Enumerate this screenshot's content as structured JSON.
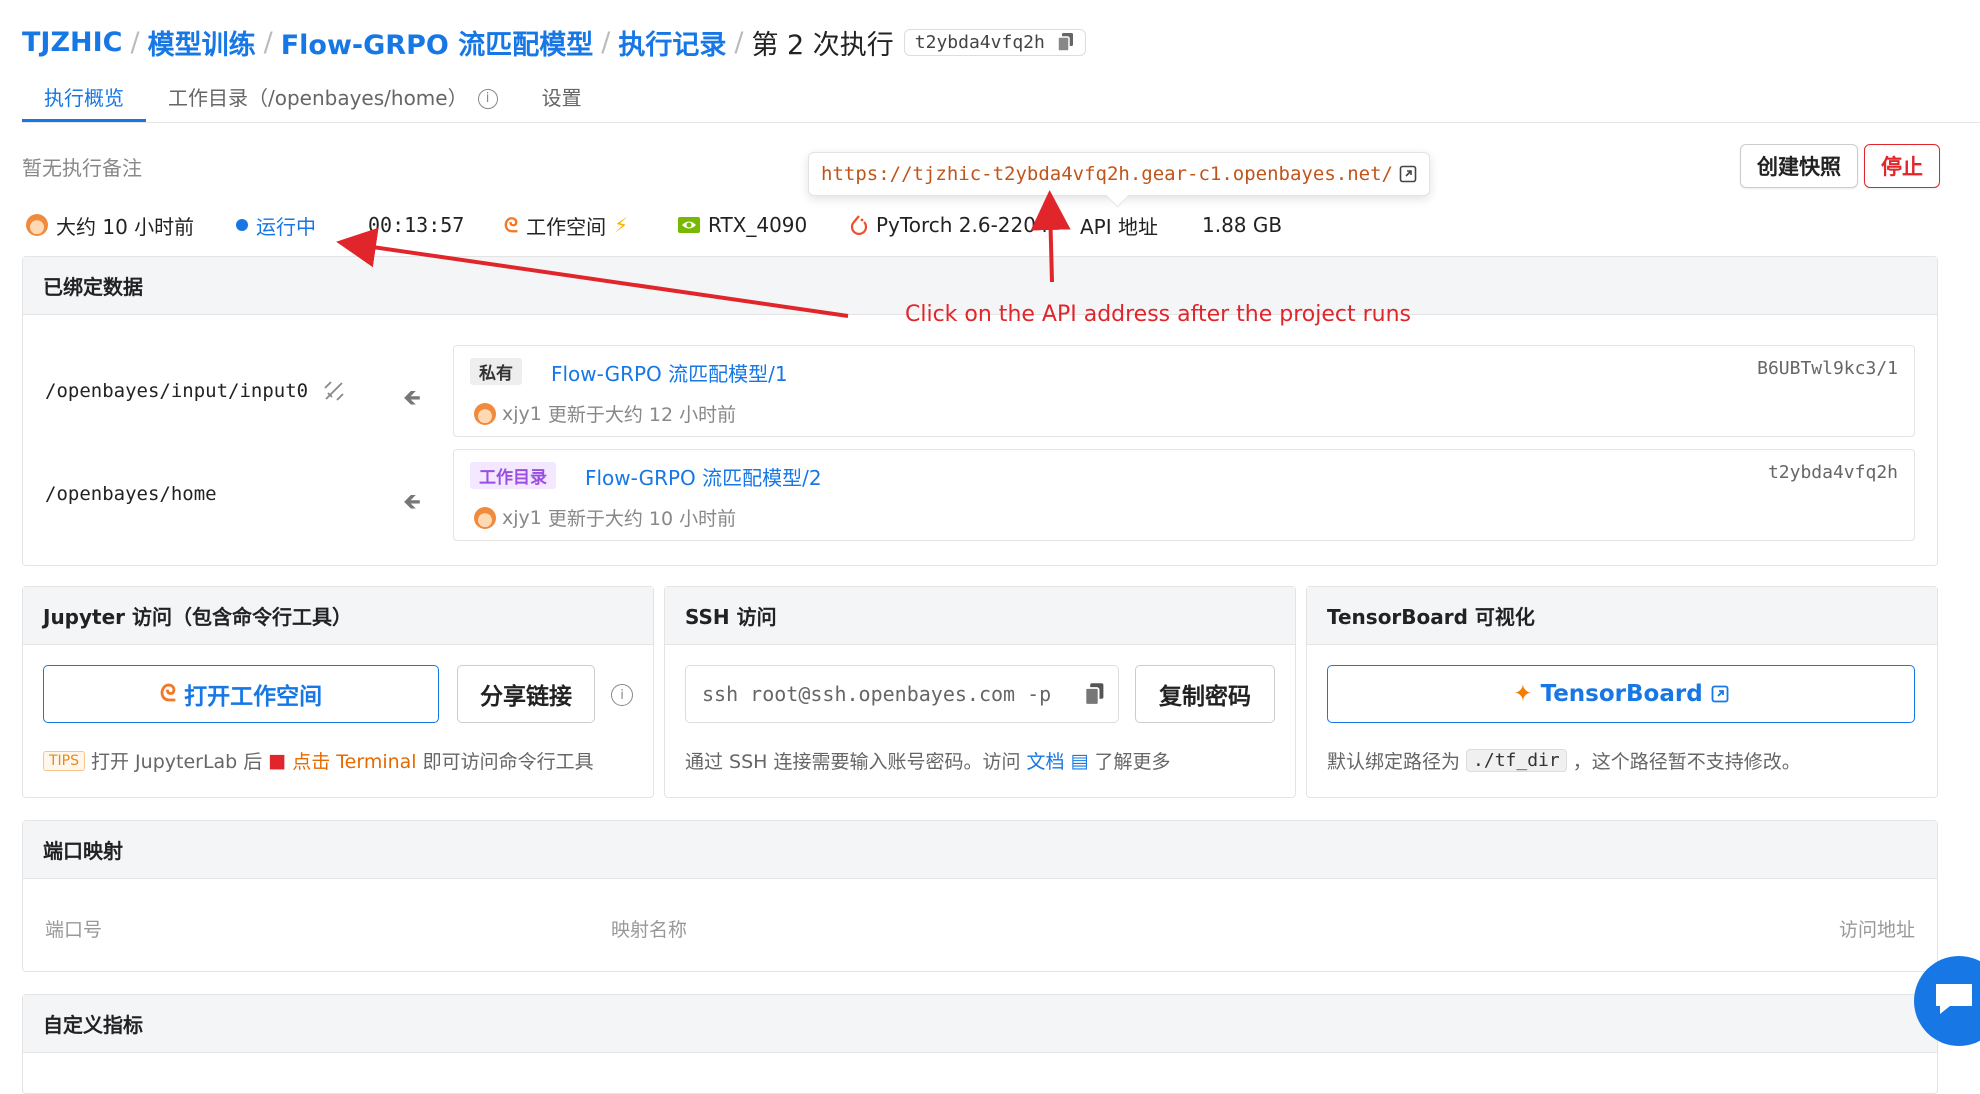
{
  "breadcrumb": {
    "items": [
      "TJZHIC",
      "模型训练",
      "Flow-GRPO 流匹配模型",
      "执行记录"
    ],
    "current": "第 2 次执行",
    "run_id": "t2ybda4vfq2h"
  },
  "tabs": [
    {
      "label": "执行概览",
      "active": true
    },
    {
      "label": "工作目录（/openbayes/home）",
      "active": false
    },
    {
      "label": "设置",
      "active": false
    }
  ],
  "note": "暂无执行备注",
  "actions": {
    "snapshot": "创建快照",
    "stop": "停止"
  },
  "api_popover": {
    "url": "https://tjzhic-t2ybda4vfq2h.gear-c1.openbayes.net/"
  },
  "status": {
    "time": "大约 10 小时前",
    "state": "运行中",
    "duration": "00:13:57",
    "workspace": "工作空间",
    "gpu": "RTX_4090",
    "framework": "PyTorch 2.6-2204",
    "api": "API 地址",
    "size": "1.88 GB"
  },
  "annotation": "Click on the API address after the project runs",
  "bound_data": {
    "title": "已绑定数据",
    "rows": [
      {
        "path": "/openbayes/input/input0",
        "badge": "私有",
        "name": "Flow-GRPO 流匹配模型/1",
        "hash": "B6UBTwl9kc3/1",
        "user": "xjy1",
        "meta": "更新于大约 12 小时前"
      },
      {
        "path": "/openbayes/home",
        "badge": "工作目录",
        "name": "Flow-GRPO 流匹配模型/2",
        "hash": "t2ybda4vfq2h",
        "user": "xjy1",
        "meta": "更新于大约 10 小时前"
      }
    ]
  },
  "jupyter": {
    "title": "Jupyter 访问（包含命令行工具）",
    "open_label": "打开工作空间",
    "share_label": "分享链接",
    "tips": "TIPS",
    "desc_pre": "打开 JupyterLab 后",
    "desc_link": "点击 Terminal",
    "desc_post": "即可访问命令行工具"
  },
  "ssh": {
    "title": "SSH 访问",
    "command": "ssh root@ssh.openbayes.com -p",
    "copy_label": "复制密码",
    "desc_pre": "通过 SSH 连接需要输入账号密码。访问",
    "desc_link": "文档",
    "desc_post": "了解更多"
  },
  "tensorboard": {
    "title": "TensorBoard 可视化",
    "button": "TensorBoard",
    "desc_pre": "默认绑定路径为",
    "path": "./tf_dir",
    "desc_post": "，这个路径暂不支持修改。"
  },
  "ports": {
    "title": "端口映射",
    "col_port": "端口号",
    "col_name": "映射名称",
    "col_url": "访问地址"
  },
  "metrics": {
    "title": "自定义指标"
  },
  "colors": {
    "accent": "#1677e5",
    "danger": "#e0262b",
    "annotation": "#e0262b"
  }
}
